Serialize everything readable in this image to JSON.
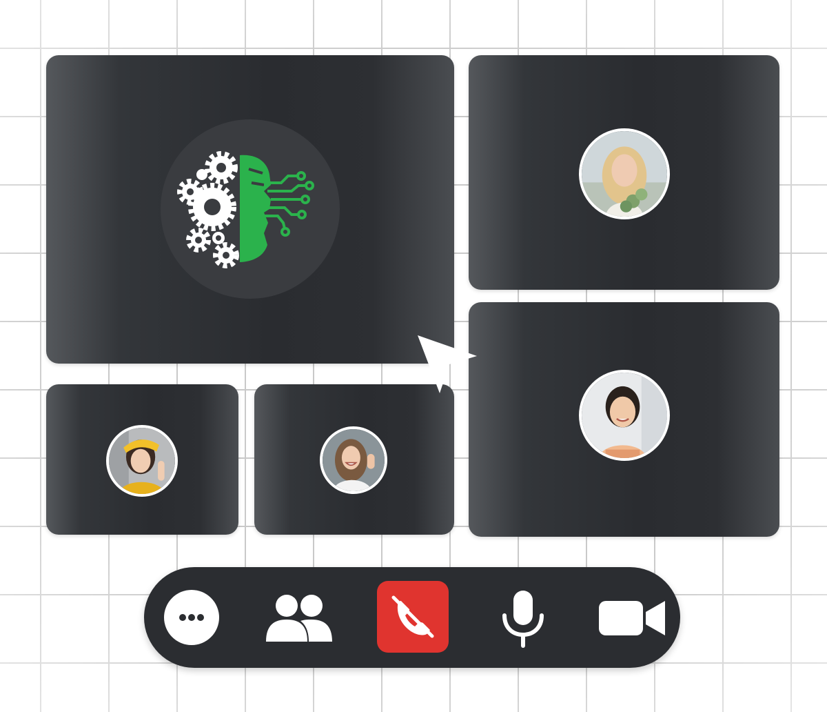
{
  "participants": [
    {
      "tile": "main",
      "type": "ai-logo",
      "icon": "ai-brain-gears-circuit-icon",
      "accent": "#2bb24c"
    },
    {
      "tile": "top-right",
      "type": "avatar",
      "icon": "blonde-woman-avatar"
    },
    {
      "tile": "bottom-right",
      "type": "avatar",
      "icon": "smiling-woman-avatar"
    },
    {
      "tile": "small-left",
      "type": "avatar",
      "icon": "woman-yellow-beret-avatar"
    },
    {
      "tile": "small-middle",
      "type": "avatar",
      "icon": "laughing-woman-avatar"
    }
  ],
  "toolbar": {
    "buttons": [
      {
        "name": "more-options",
        "icon": "ellipsis-icon"
      },
      {
        "name": "participants",
        "icon": "people-icon"
      },
      {
        "name": "end-call",
        "icon": "phone-off-icon",
        "color": "#e0342f"
      },
      {
        "name": "microphone",
        "icon": "microphone-icon"
      },
      {
        "name": "camera",
        "icon": "video-camera-icon"
      }
    ]
  },
  "colors": {
    "tile_bg": "#2a2c30",
    "toolbar_bg": "#2b2d31",
    "accent_green": "#2bb24c",
    "end_call_red": "#e0342f"
  }
}
